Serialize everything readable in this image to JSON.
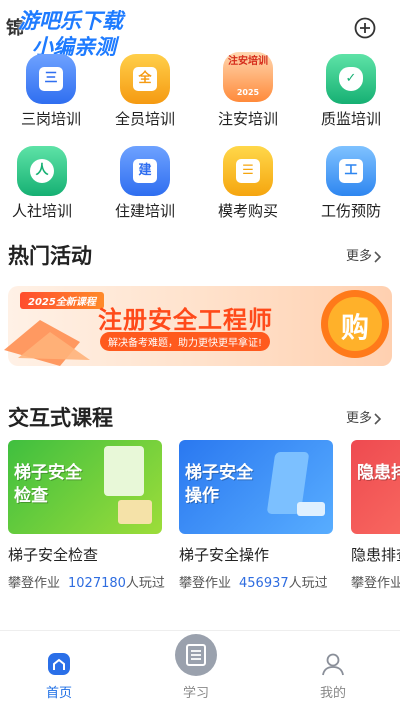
{
  "header": {
    "app_title": "锦",
    "watermark_line1": "游吧乐下载",
    "watermark_line2": "小编亲测",
    "add_icon": "plus-circle-icon"
  },
  "categories": [
    {
      "label": "三岗培训",
      "glyph": "三",
      "icon": "book-icon",
      "color": "#3f7cf5"
    },
    {
      "label": "全员培训",
      "glyph": "全",
      "icon": "book-icon",
      "color": "#f5a623"
    },
    {
      "label": "注安培训",
      "glyph": "注安培训",
      "badge": "2025",
      "icon": "badge-icon",
      "color": "#f0643c"
    },
    {
      "label": "质监培训",
      "glyph": "✓",
      "icon": "shield-check-icon",
      "color": "#20b87a"
    },
    {
      "label": "人社培训",
      "glyph": "人",
      "icon": "person-icon",
      "color": "#20b87a"
    },
    {
      "label": "住建培训",
      "glyph": "建",
      "icon": "building-icon",
      "color": "#3f7cf5"
    },
    {
      "label": "模考购买",
      "glyph": "☰",
      "icon": "shopping-bag-icon",
      "color": "#f5b623"
    },
    {
      "label": "工伤预防",
      "glyph": "工",
      "icon": "worker-card-icon",
      "color": "#3f8cf5"
    }
  ],
  "hot": {
    "title": "热门活动",
    "more": "更多",
    "banner": {
      "tag": "2025全新课程",
      "headline": "注册安全工程师",
      "subline": "解决备考难题，助力更快更早拿证!",
      "cta": "购"
    }
  },
  "interactive": {
    "title": "交互式课程",
    "more": "更多",
    "courses": [
      {
        "thumb_text_1": "梯子安全",
        "thumb_text_2": "检查",
        "title": "梯子安全检查",
        "category": "攀登作业",
        "count": "1027180",
        "suffix": "人玩过",
        "color1": "#4cc24a",
        "color2": "#8ad93c"
      },
      {
        "thumb_text_1": "梯子安全",
        "thumb_text_2": "操作",
        "title": "梯子安全操作",
        "category": "攀登作业",
        "count": "456937",
        "suffix": "人玩过",
        "color1": "#2c7ef2",
        "color2": "#4aa3ff"
      },
      {
        "thumb_text_1": "隐患排",
        "thumb_text_2": "",
        "title": "隐患排查",
        "category": "攀登作业",
        "count": "",
        "suffix": "",
        "color1": "#ef4f55",
        "color2": "#ff7a6a"
      }
    ]
  },
  "nav": {
    "items": [
      {
        "label": "首页",
        "icon": "home-icon",
        "active": true
      },
      {
        "label": "学习",
        "icon": "study-icon",
        "active": false
      },
      {
        "label": "我的",
        "icon": "user-icon",
        "active": false
      }
    ]
  },
  "colors": {
    "accent": "#1f6fe5",
    "banner_orange": "#ff6a1a"
  }
}
